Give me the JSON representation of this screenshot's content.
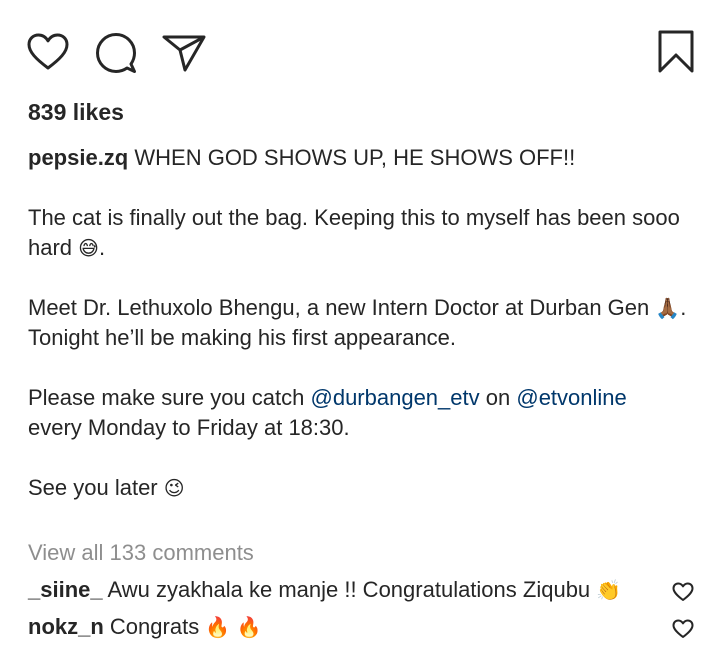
{
  "actions": {
    "like_icon": "heart-icon",
    "comment_icon": "comment-bubble-icon",
    "share_icon": "paper-plane-icon",
    "save_icon": "bookmark-icon"
  },
  "likes_text": "839 likes",
  "caption": {
    "username": "pepsie.zq",
    "headline": "WHEN GOD SHOWS UP, HE SHOWS OFF!!",
    "line1": "The cat is finally out the bag. Keeping this to myself has been sooo hard",
    "line1_emoji": "😅",
    "line2": "Meet Dr. Lethuxolo Bhengu, a new Intern Doctor at Durban Gen",
    "line2_emoji": "🙏🏾",
    "line3": "Tonight he’ll be making his first appearance.",
    "line4_prefix": "Please make sure you catch",
    "mention1": "@durbangen_etv",
    "line4_mid": "on",
    "mention2": "@etvonline",
    "line5": "every Monday to Friday at 18:30.",
    "line6": "See you later",
    "line6_emoji": "😉"
  },
  "view_all_comments": "View all 133 comments",
  "comments": [
    {
      "username": "_siine_",
      "text": "Awu zyakhala ke manje !! Congratulations Ziqubu",
      "emoji": "👏"
    },
    {
      "username": "nokz_n",
      "text": "Congrats",
      "emoji": "🔥 🔥"
    }
  ],
  "colors": {
    "text": "#262626",
    "muted": "#8e8e8e",
    "mention": "#00376b",
    "background": "#ffffff"
  }
}
